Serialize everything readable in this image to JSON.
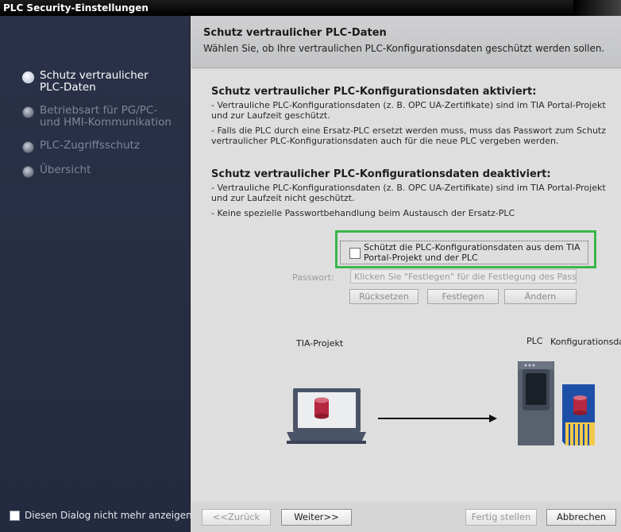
{
  "window": {
    "title": "PLC Security-Einstellungen"
  },
  "sidebar": {
    "steps": [
      {
        "label": "Schutz vertraulicher PLC-Daten",
        "active": true
      },
      {
        "label": "Betriebsart für PG/PC- und HMI-Kommunikation",
        "active": false
      },
      {
        "label": "PLC-Zugriffsschutz",
        "active": false
      },
      {
        "label": "Übersicht",
        "active": false
      }
    ],
    "dont_show_label": "Diesen Dialog nicht mehr anzeigen"
  },
  "header": {
    "title": "Schutz vertraulicher PLC-Daten",
    "subtitle": "Wählen Sie, ob Ihre vertraulichen PLC-Konfigurationsdaten geschützt werden sollen."
  },
  "content": {
    "activated": {
      "title": "Schutz vertraulicher PLC-Konfigurationsdaten aktiviert:",
      "line1": "- Vertrauliche PLC-Konfigurationsdaten (z. B. OPC UA-Zertifikate) sind im TIA Portal-Projekt und zur Laufzeit geschützt.",
      "line2": "- Falls die PLC durch eine Ersatz-PLC ersetzt werden muss, muss das Passwort zum Schutz vertraulicher PLC-Konfigurationsdaten auch für die neue PLC vergeben werden."
    },
    "deactivated": {
      "title": "Schutz vertraulicher PLC-Konfigurationsdaten deaktiviert:",
      "line1": "- Vertrauliche PLC-Konfigurationsdaten (z. B. OPC UA-Zertifikate) sind im TIA Portal-Projekt und zur Laufzeit nicht geschützt.",
      "line2": "- Keine spezielle Passwortbehandlung beim Austausch der Ersatz-PLC"
    },
    "protect_checkbox": {
      "label": "Schützt die PLC-Konfigurationsdaten aus dem TIA Portal-Projekt und der PLC",
      "checked": false
    },
    "password": {
      "label": "Passwort:",
      "placeholder": "Klicken Sie \"Festlegen\" für die Festlegung des Passw"
    },
    "buttons": {
      "reset": "Rücksetzen",
      "set": "Festlegen",
      "change": "Ändern"
    },
    "diagram": {
      "tia_label": "TIA-Projekt",
      "plc_label": "PLC",
      "config_label": "Konfigurationsdaten"
    }
  },
  "footer": {
    "back": "<<Zurück",
    "next": "Weiter>>",
    "finish": "Fertig stellen",
    "cancel": "Abbrechen"
  },
  "colors": {
    "highlight": "#3bb54a",
    "sidebar": "#262c41",
    "cylinder": "#b5283f"
  }
}
